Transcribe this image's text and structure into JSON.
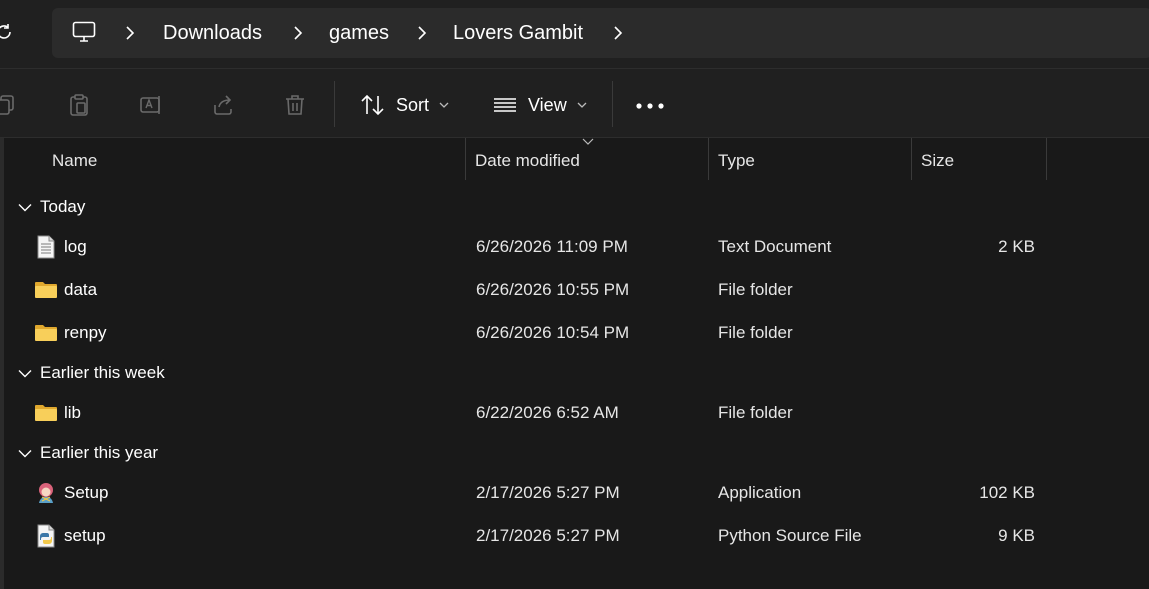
{
  "window": {
    "breadcrumb": [
      "Downloads",
      "games",
      "Lovers Gambit"
    ]
  },
  "toolbar": {
    "sort_label": "Sort",
    "view_label": "View",
    "icons": [
      "copy-icon",
      "paste-icon",
      "rename-icon",
      "share-icon",
      "delete-icon",
      "sort-icon",
      "view-icon",
      "more-icon"
    ]
  },
  "columns": {
    "name": "Name",
    "date": "Date modified",
    "type": "Type",
    "size": "Size"
  },
  "groups": [
    {
      "label": "Today",
      "items": [
        {
          "name": "log",
          "date": "6/26/2026 11:09 PM",
          "type": "Text Document",
          "size": "2 KB",
          "icon": "text-file-icon"
        },
        {
          "name": "data",
          "date": "6/26/2026 10:55 PM",
          "type": "File folder",
          "size": "",
          "icon": "folder-icon"
        },
        {
          "name": "renpy",
          "date": "6/26/2026 10:54 PM",
          "type": "File folder",
          "size": "",
          "icon": "folder-icon"
        }
      ]
    },
    {
      "label": "Earlier this week",
      "items": [
        {
          "name": "lib",
          "date": "6/22/2026 6:52 AM",
          "type": "File folder",
          "size": "",
          "icon": "folder-icon"
        }
      ]
    },
    {
      "label": "Earlier this year",
      "items": [
        {
          "name": "Setup",
          "date": "2/17/2026 5:27 PM",
          "type": "Application",
          "size": "102 KB",
          "icon": "app-icon"
        },
        {
          "name": "setup",
          "date": "2/17/2026 5:27 PM",
          "type": "Python Source File",
          "size": "9 KB",
          "icon": "python-file-icon"
        }
      ]
    }
  ],
  "colors": {
    "background": "#191919",
    "bar": "#202020",
    "address": "#2b2b2b",
    "folder": "#f4c54a"
  }
}
